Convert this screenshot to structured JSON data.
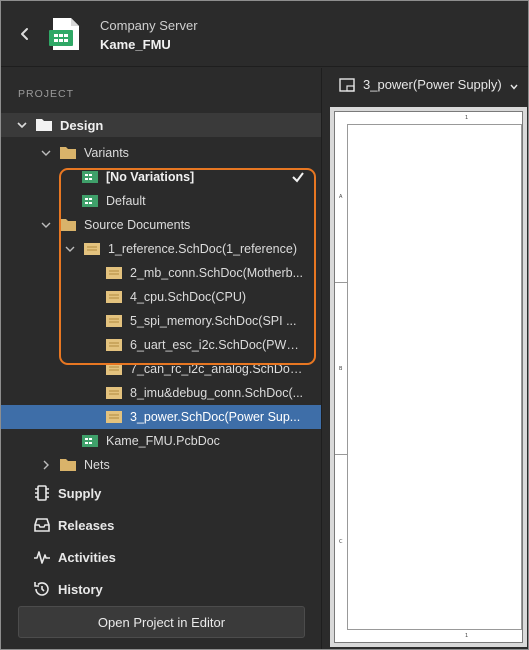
{
  "header": {
    "server_name": "Company Server",
    "project_name": "Kame_FMU"
  },
  "sidebar": {
    "section_label": "PROJECT",
    "design_label": "Design",
    "tree": {
      "variants_label": "Variants",
      "variants": [
        {
          "label": "[No Variations]",
          "checked": true
        },
        {
          "label": "Default",
          "checked": false
        }
      ],
      "source_documents_label": "Source Documents",
      "root_schematic": "1_reference.SchDoc(1_reference)",
      "child_schematics": [
        "2_mb_conn.SchDoc(Motherb...",
        "4_cpu.SchDoc(CPU)",
        "5_spi_memory.SchDoc(SPI ...",
        "6_uart_esc_i2c.SchDoc(PWM...",
        "7_can_rc_i2c_analog.SchDoc...",
        "8_imu&debug_conn.SchDoc(...",
        "3_power.SchDoc(Power Sup..."
      ],
      "selected_index": 6,
      "pcb_doc": "Kame_FMU.PcbDoc",
      "nets_label": "Nets"
    },
    "nav": [
      {
        "label": "Supply",
        "icon": "chip-icon"
      },
      {
        "label": "Releases",
        "icon": "inbox-icon"
      },
      {
        "label": "Activities",
        "icon": "pulse-icon"
      },
      {
        "label": "History",
        "icon": "history-icon"
      }
    ],
    "open_button_label": "Open Project in Editor"
  },
  "document_panel": {
    "selected_document": "3_power(Power Supply)",
    "sheet_zones_top": "1",
    "sheet_zones_bottom": "1",
    "sheet_zones_left": [
      "A",
      "B",
      "C"
    ]
  },
  "colors": {
    "background": "#2b2b2b",
    "selection": "#3e6ea8",
    "highlight": "#e87722",
    "folder": "#d9b36a",
    "pcb_green": "#3fa06a"
  }
}
